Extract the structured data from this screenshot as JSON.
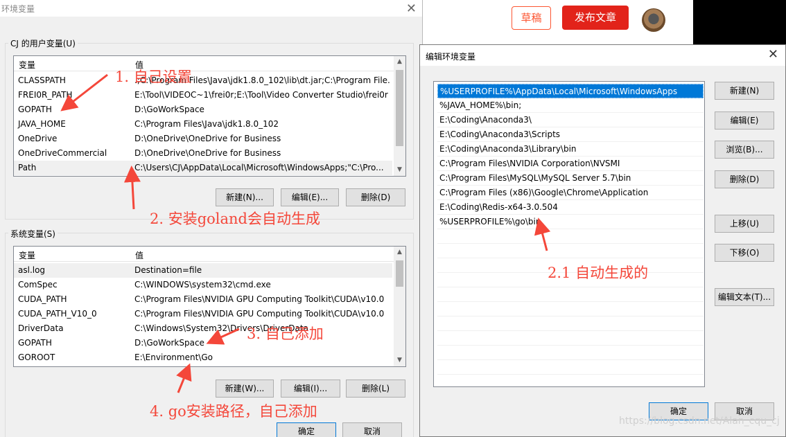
{
  "blog": {
    "draft_label": "草稿",
    "publish_label": "发布文章"
  },
  "env_dialog": {
    "title": "环境变量",
    "user_group_label": "CJ 的用户变量(U)",
    "user_columns": [
      "变量",
      "值"
    ],
    "user_vars": [
      {
        "name": "CLASSPATH",
        "value": ".;C:\\Program Files\\Java\\jdk1.8.0_102\\lib\\dt.jar;C:\\Program File..."
      },
      {
        "name": "FREI0R_PATH",
        "value": "E:\\Tool\\VIDEOC~1\\frei0r;E:\\Tool\\Video Converter Studio\\frei0r"
      },
      {
        "name": "GOPATH",
        "value": "D:\\GoWorkSpace"
      },
      {
        "name": "JAVA_HOME",
        "value": "C:\\Program Files\\Java\\jdk1.8.0_102"
      },
      {
        "name": "OneDrive",
        "value": "D:\\OneDrive\\OneDrive for Business"
      },
      {
        "name": "OneDriveCommercial",
        "value": "D:\\OneDrive\\OneDrive for Business"
      },
      {
        "name": "Path",
        "value": "C:\\Users\\CJ\\AppData\\Local\\Microsoft\\WindowsApps;\"C:\\Pro..."
      }
    ],
    "user_buttons": {
      "new": "新建(N)...",
      "edit": "编辑(E)...",
      "delete": "删除(D)"
    },
    "system_group_label": "系统变量(S)",
    "system_columns": [
      "变量",
      "值"
    ],
    "system_vars": [
      {
        "name": "asl.log",
        "value": "Destination=file"
      },
      {
        "name": "ComSpec",
        "value": "C:\\WINDOWS\\system32\\cmd.exe"
      },
      {
        "name": "CUDA_PATH",
        "value": "C:\\Program Files\\NVIDIA GPU Computing Toolkit\\CUDA\\v10.0"
      },
      {
        "name": "CUDA_PATH_V10_0",
        "value": "C:\\Program Files\\NVIDIA GPU Computing Toolkit\\CUDA\\v10.0"
      },
      {
        "name": "DriverData",
        "value": "C:\\Windows\\System32\\Drivers\\DriverData"
      },
      {
        "name": "GOPATH",
        "value": "D:\\GoWorkSpace"
      },
      {
        "name": "GOROOT",
        "value": "E:\\Environment\\Go"
      }
    ],
    "system_buttons": {
      "new": "新建(W)...",
      "edit": "编辑(I)...",
      "delete": "删除(L)"
    },
    "ok_label": "确定",
    "cancel_label": "取消"
  },
  "edit_dialog": {
    "title": "编辑环境变量",
    "paths": [
      "%USERPROFILE%\\AppData\\Local\\Microsoft\\WindowsApps",
      "%JAVA_HOME%\\bin;",
      "E:\\Coding\\Anaconda3\\",
      "E:\\Coding\\Anaconda3\\Scripts",
      "E:\\Coding\\Anaconda3\\Library\\bin",
      "C:\\Program Files\\NVIDIA Corporation\\NVSMI",
      "C:\\Program Files\\MySQL\\MySQL Server 5.7\\bin",
      "C:\\Program Files (x86)\\Google\\Chrome\\Application",
      "E:\\Coding\\Redis-x64-3.0.504",
      "%USERPROFILE%\\go\\bin"
    ],
    "buttons": {
      "new": "新建(N)",
      "edit": "编辑(E)",
      "browse": "浏览(B)...",
      "delete": "删除(D)",
      "move_up": "上移(U)",
      "move_down": "下移(O)",
      "edit_text": "编辑文本(T)...",
      "ok": "确定",
      "cancel": "取消"
    }
  },
  "annotations": {
    "note1": "1.  自己设置",
    "note2": "2.  安装goland会自动生成",
    "note21": "2.1  自动生成的",
    "note3": "3.  自己添加",
    "note4": "4.  go安装路径，自己添加"
  },
  "watermark": "https://blog.csdn.net/Alan_cqu_cj"
}
